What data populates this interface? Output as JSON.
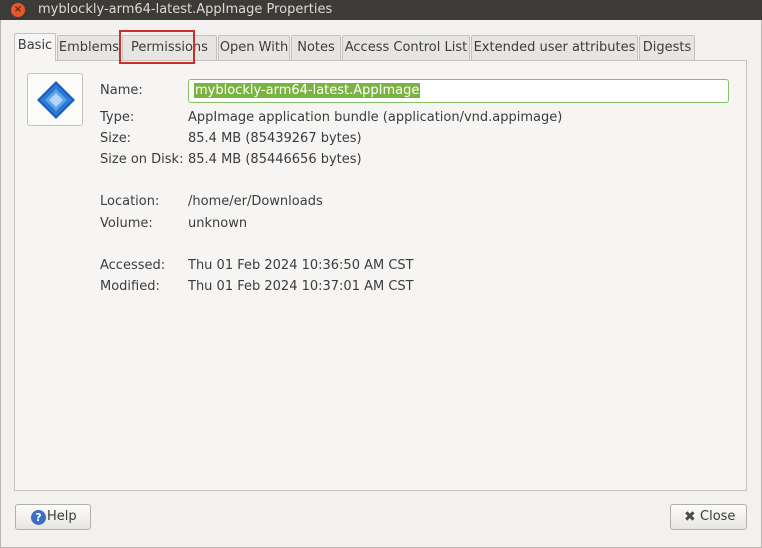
{
  "window": {
    "title": "myblockly-arm64-latest.AppImage Properties",
    "close_glyph": "×"
  },
  "tabs": [
    {
      "label": "Basic",
      "active": true
    },
    {
      "label": "Emblems"
    },
    {
      "label": "Permissions",
      "highlighted": true
    },
    {
      "label": "Open With"
    },
    {
      "label": "Notes"
    },
    {
      "label": "Access Control List"
    },
    {
      "label": "Extended user attributes"
    },
    {
      "label": "Digests"
    }
  ],
  "basic": {
    "file_icon": "appimage-file-icon",
    "name_label": "Name:",
    "name_value": "myblockly-arm64-latest.AppImage",
    "type_label": "Type:",
    "type_value": "AppImage application bundle (application/vnd.appimage)",
    "size_label": "Size:",
    "size_value": "85.4 MB (85439267 bytes)",
    "disk_label": "Size on Disk:",
    "disk_value": "85.4 MB (85446656 bytes)",
    "location_label": "Location:",
    "location_value": "/home/er/Downloads",
    "volume_label": "Volume:",
    "volume_value": "unknown",
    "accessed_label": "Accessed:",
    "accessed_value": "Thu 01 Feb 2024 10:36:50 AM CST",
    "modified_label": "Modified:",
    "modified_value": "Thu 01 Feb 2024 10:37:01 AM CST"
  },
  "buttons": {
    "help_icon": "?",
    "help_label": "Help",
    "close_icon": "✖",
    "close_label": "Close"
  },
  "colors": {
    "selection": "#7ab341",
    "highlight_box": "#c9302c",
    "titlebar": "#3c3b37"
  }
}
